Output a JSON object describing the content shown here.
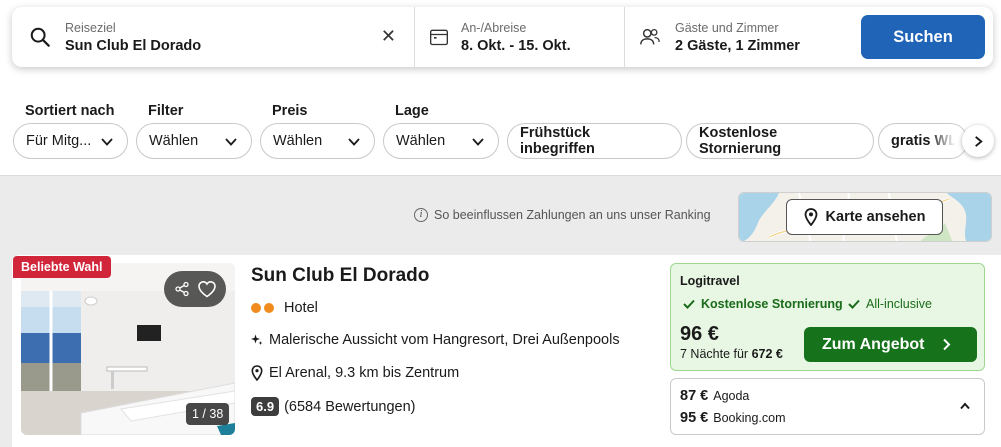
{
  "search": {
    "destination_label": "Reiseziel",
    "destination_value": "Sun Club El Dorado",
    "clear_glyph": "✕",
    "dates_label": "An-/Abreise",
    "dates_value": "8. Okt. - 15. Okt.",
    "guests_label": "Gäste und Zimmer",
    "guests_value": "2 Gäste, 1 Zimmer",
    "search_button": "Suchen"
  },
  "filters": {
    "sort_label": "Sortiert nach",
    "sort_value": "Für Mitg...",
    "filter_label": "Filter",
    "filter_value": "Wählen",
    "price_label": "Preis",
    "price_value": "Wählen",
    "location_label": "Lage",
    "location_value": "Wählen",
    "chip_breakfast": "Frühstück inbegriffen",
    "chip_cancellation": "Kostenlose Stornierung",
    "chip_wifi": "gratis WLAN"
  },
  "ranking_info": "So beeinflussen Zahlungen an uns unser Ranking",
  "map_button": "Karte ansehen",
  "hotel": {
    "badge": "Beliebte Wahl",
    "photo_count": "1 / 38",
    "name": "Sun Club El Dorado",
    "type": "Hotel",
    "feature": "Malerische Aussicht vom Hangresort, Drei Außenpools",
    "location": "El Arenal, 9.3 km bis Zentrum",
    "rating": "6.9",
    "reviews": "(6584 Bewertungen)"
  },
  "offer": {
    "provider": "Logitravel",
    "check1": "Kostenlose Stornierung",
    "check2": "All-inclusive",
    "price": "96 €",
    "nights_prefix": "7 Nächte für",
    "nights_total": "672 €",
    "cta": "Zum Angebot"
  },
  "other_offers": [
    {
      "price": "87 €",
      "provider": "Agoda"
    },
    {
      "price": "95 €",
      "provider": "Booking.com"
    }
  ],
  "colors": {
    "primary_blue": "#1f64b7",
    "cta_green": "#16731b",
    "badge_red": "#d1253a",
    "offer_bg": "#e8f7e4"
  }
}
